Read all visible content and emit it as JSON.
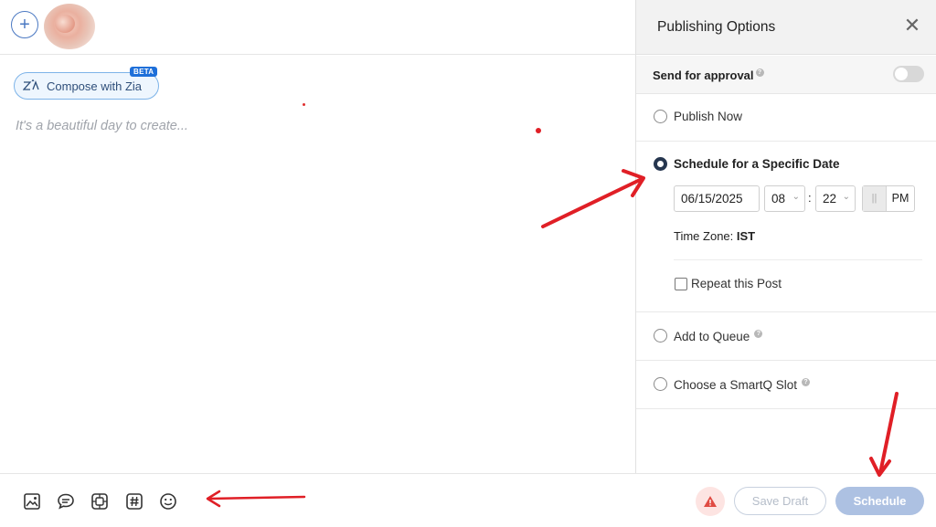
{
  "composer": {
    "add_icon": "plus-icon",
    "compose_label": "Compose with Zia",
    "beta_badge": "BETA",
    "placeholder": "It's a beautiful day to create..."
  },
  "toolbar": {
    "tools": [
      "image-icon",
      "comment-icon",
      "media-library-icon",
      "hashtag-icon",
      "emoji-icon"
    ],
    "save_draft_label": "Save Draft",
    "schedule_label": "Schedule"
  },
  "panel": {
    "title": "Publishing Options",
    "send_for_approval_label": "Send for approval",
    "send_for_approval_on": false,
    "options": {
      "publish_now": "Publish Now",
      "schedule_specific": "Schedule for a Specific Date",
      "add_to_queue": "Add to Queue",
      "smartq_slot": "Choose a SmartQ Slot"
    },
    "selected_option": "schedule_specific",
    "schedule": {
      "date": "06/15/2025",
      "hour": "08",
      "minute": "22",
      "colon": ":",
      "am_label": "||",
      "pm_label": "PM",
      "timezone_label": "Time Zone:",
      "timezone_value": "IST",
      "repeat_label": "Repeat this Post",
      "repeat_checked": false
    }
  },
  "colors": {
    "accent_blue": "#4a78c2",
    "annotation_red": "#e01f26",
    "schedule_button": "#adc1e2"
  }
}
